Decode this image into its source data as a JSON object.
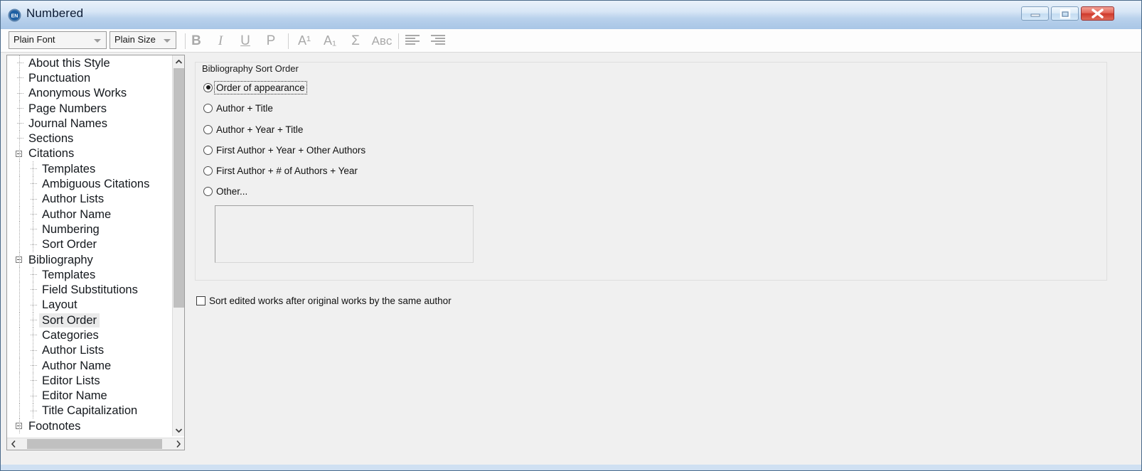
{
  "window": {
    "title": "Numbered",
    "icon": "endnote-en-icon",
    "controls": {
      "minimize": "Minimize",
      "maximize": "Maximize",
      "close": "Close"
    },
    "accent_blue": "#2f6aa8",
    "frame_color": "#cfe0f2",
    "close_red": "#cf3a2c"
  },
  "toolbar": {
    "font_combo": {
      "value": "Plain Font"
    },
    "size_combo": {
      "value": "Plain Size"
    },
    "buttons": [
      {
        "name": "bold-button",
        "label": "B"
      },
      {
        "name": "italic-button",
        "label": "I"
      },
      {
        "name": "underline-button",
        "label": "U"
      },
      {
        "name": "plain-button",
        "label": "P"
      },
      {
        "name": "superscript-button",
        "label": "A¹"
      },
      {
        "name": "subscript-button",
        "label": "A₁"
      },
      {
        "name": "symbol-button",
        "label": "Σ"
      },
      {
        "name": "spellcheck-button",
        "label": "Aʙᴄ"
      },
      {
        "name": "align-left-button",
        "label": ""
      },
      {
        "name": "align-right-button",
        "label": ""
      }
    ]
  },
  "tree": {
    "items": [
      {
        "label": "About this Style",
        "level": 1,
        "expander": "none"
      },
      {
        "label": "Punctuation",
        "level": 1,
        "expander": "none"
      },
      {
        "label": "Anonymous Works",
        "level": 1,
        "expander": "none"
      },
      {
        "label": "Page Numbers",
        "level": 1,
        "expander": "none"
      },
      {
        "label": "Journal Names",
        "level": 1,
        "expander": "none"
      },
      {
        "label": "Sections",
        "level": 1,
        "expander": "none"
      },
      {
        "label": "Citations",
        "level": 1,
        "expander": "minus"
      },
      {
        "label": "Templates",
        "level": 2,
        "expander": "none"
      },
      {
        "label": "Ambiguous Citations",
        "level": 2,
        "expander": "none"
      },
      {
        "label": "Author Lists",
        "level": 2,
        "expander": "none"
      },
      {
        "label": "Author Name",
        "level": 2,
        "expander": "none"
      },
      {
        "label": "Numbering",
        "level": 2,
        "expander": "none"
      },
      {
        "label": "Sort Order",
        "level": 2,
        "expander": "none"
      },
      {
        "label": "Bibliography",
        "level": 1,
        "expander": "minus"
      },
      {
        "label": "Templates",
        "level": 2,
        "expander": "none"
      },
      {
        "label": "Field Substitutions",
        "level": 2,
        "expander": "none"
      },
      {
        "label": "Layout",
        "level": 2,
        "expander": "none"
      },
      {
        "label": "Sort Order",
        "level": 2,
        "expander": "none",
        "selected": true
      },
      {
        "label": "Categories",
        "level": 2,
        "expander": "none"
      },
      {
        "label": "Author Lists",
        "level": 2,
        "expander": "none"
      },
      {
        "label": "Author Name",
        "level": 2,
        "expander": "none"
      },
      {
        "label": "Editor Lists",
        "level": 2,
        "expander": "none"
      },
      {
        "label": "Editor Name",
        "level": 2,
        "expander": "none"
      },
      {
        "label": "Title Capitalization",
        "level": 2,
        "expander": "none"
      },
      {
        "label": "Footnotes",
        "level": 1,
        "expander": "minus"
      }
    ],
    "vertical_scrollbar": {
      "name": "tree-vertical-scrollbar"
    },
    "horizontal_scrollbar": {
      "name": "tree-horizontal-scrollbar"
    }
  },
  "panel": {
    "groupbox_title": "Bibliography Sort Order",
    "radio_options": [
      {
        "label": "Order of appearance",
        "selected": true,
        "focused": true
      },
      {
        "label": "Author + Title",
        "selected": false,
        "focused": false
      },
      {
        "label": "Author + Year + Title",
        "selected": false,
        "focused": false
      },
      {
        "label": "First Author + Year + Other Authors",
        "selected": false,
        "focused": false
      },
      {
        "label": "First Author + # of Authors + Year",
        "selected": false,
        "focused": false
      },
      {
        "label": "Other...",
        "selected": false,
        "focused": false
      }
    ],
    "other_textbox": {
      "value": "",
      "placeholder": ""
    },
    "checkbox": {
      "label": "Sort edited works after original works by the same author",
      "checked": false
    }
  }
}
